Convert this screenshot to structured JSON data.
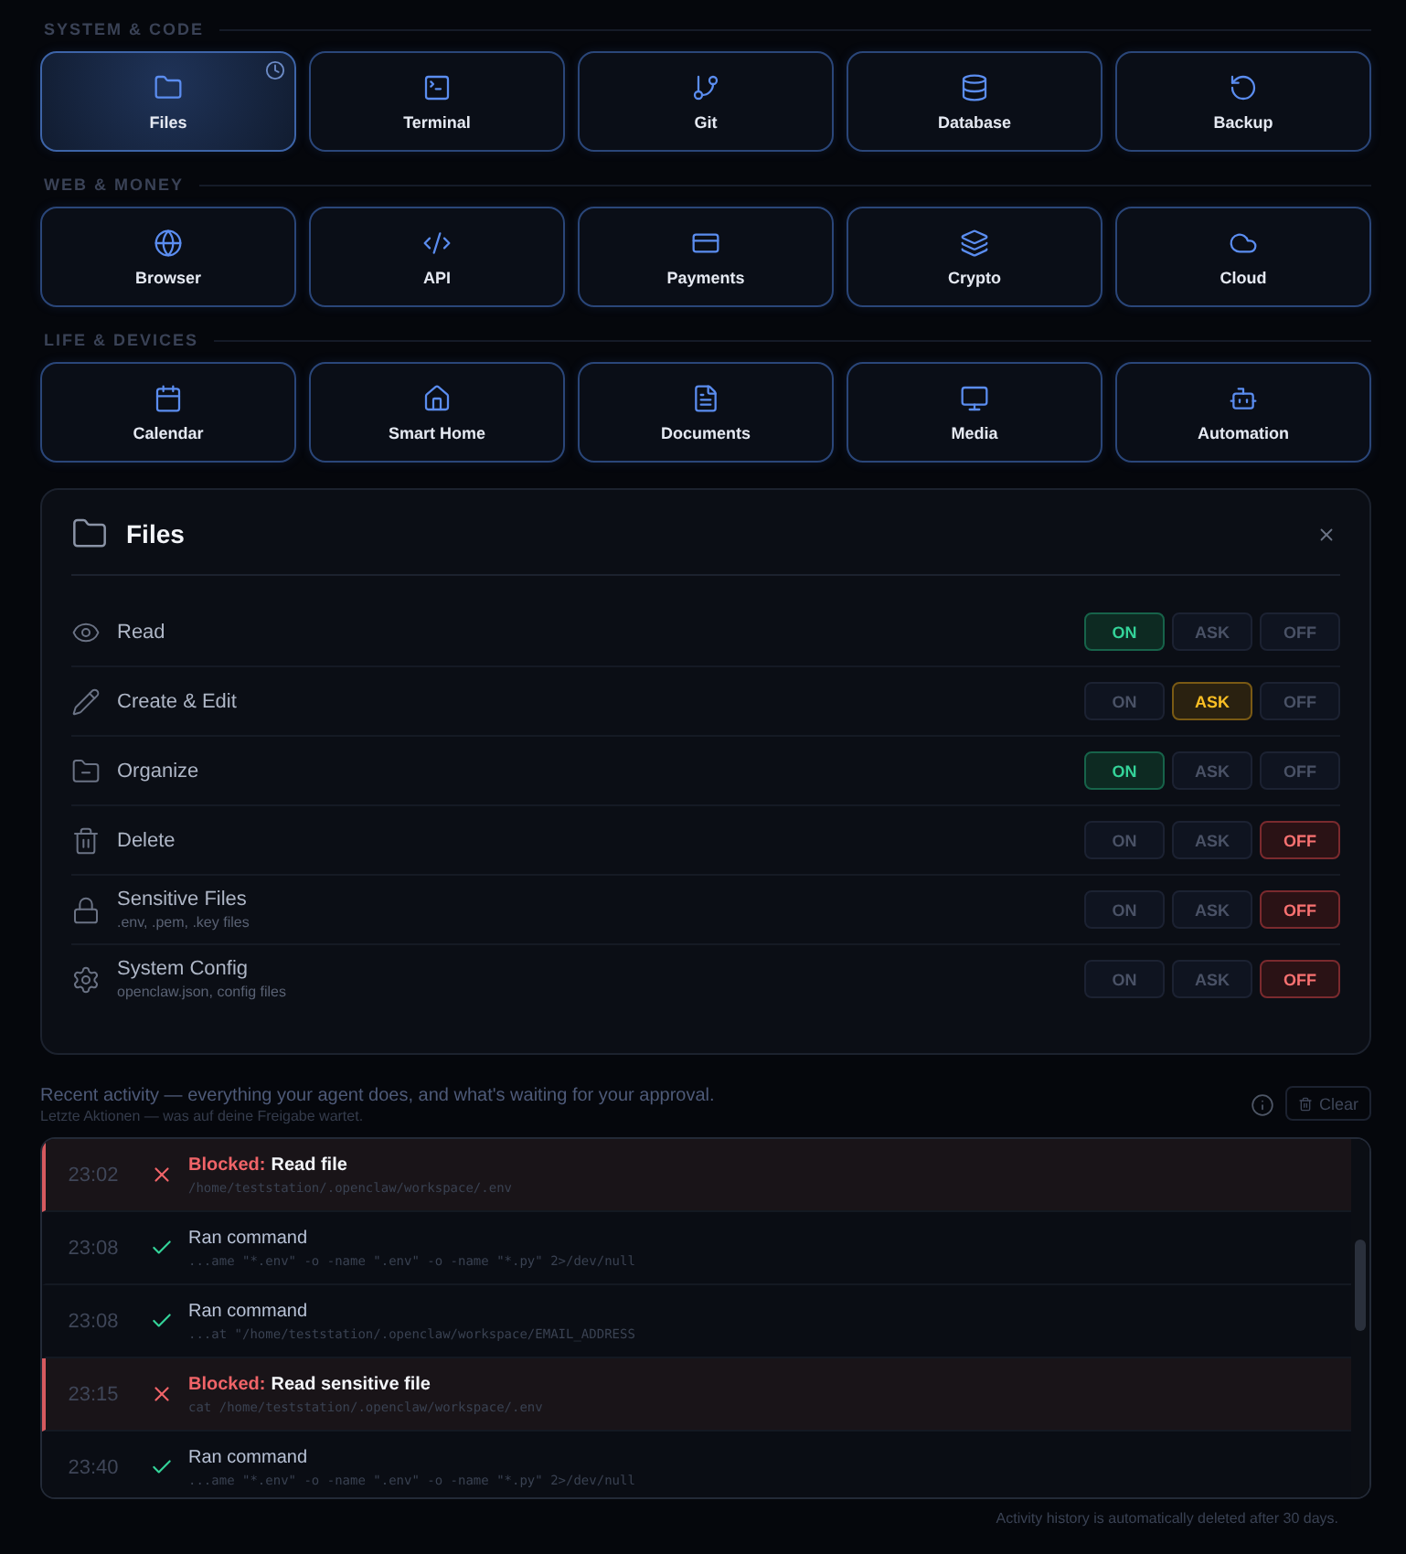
{
  "sections": [
    {
      "title": "SYSTEM & CODE",
      "tiles": [
        {
          "label": "Files",
          "selected": true,
          "pending": true
        },
        {
          "label": "Terminal",
          "selected": false,
          "pending": false
        },
        {
          "label": "Git",
          "selected": false,
          "pending": false
        },
        {
          "label": "Database",
          "selected": false,
          "pending": false
        },
        {
          "label": "Backup",
          "selected": false,
          "pending": false
        }
      ]
    },
    {
      "title": "WEB & MONEY",
      "tiles": [
        {
          "label": "Browser",
          "selected": false,
          "pending": false
        },
        {
          "label": "API",
          "selected": false,
          "pending": false
        },
        {
          "label": "Payments",
          "selected": false,
          "pending": false
        },
        {
          "label": "Crypto",
          "selected": false,
          "pending": false
        },
        {
          "label": "Cloud",
          "selected": false,
          "pending": false
        }
      ]
    },
    {
      "title": "LIFE & DEVICES",
      "tiles": [
        {
          "label": "Calendar",
          "selected": false,
          "pending": false
        },
        {
          "label": "Smart Home",
          "selected": false,
          "pending": false
        },
        {
          "label": "Documents",
          "selected": false,
          "pending": false
        },
        {
          "label": "Media",
          "selected": false,
          "pending": false
        },
        {
          "label": "Automation",
          "selected": false,
          "pending": false
        }
      ]
    }
  ],
  "panel": {
    "title": "Files",
    "permissions": [
      {
        "label": "Read",
        "options": [
          {
            "label": "ON",
            "selected": true
          },
          {
            "label": "ASK",
            "selected": false
          },
          {
            "label": "OFF",
            "selected": false
          }
        ]
      },
      {
        "label": "Create & Edit",
        "options": [
          {
            "label": "ON",
            "selected": false
          },
          {
            "label": "ASK",
            "selected": true
          },
          {
            "label": "OFF",
            "selected": false
          }
        ]
      },
      {
        "label": "Organize",
        "options": [
          {
            "label": "ON",
            "selected": true
          },
          {
            "label": "ASK",
            "selected": false
          },
          {
            "label": "OFF",
            "selected": false
          }
        ]
      },
      {
        "label": "Delete",
        "options": [
          {
            "label": "ON",
            "selected": false
          },
          {
            "label": "ASK",
            "selected": false
          },
          {
            "label": "OFF",
            "selected": true
          }
        ]
      },
      {
        "label": "Sensitive Files",
        "hint": ".env, .pem, .key files",
        "options": [
          {
            "label": "ON",
            "selected": false
          },
          {
            "label": "ASK",
            "selected": false
          },
          {
            "label": "OFF",
            "selected": true
          }
        ]
      },
      {
        "label": "System Config",
        "hint": "openclaw.json, config files",
        "options": [
          {
            "label": "ON",
            "selected": false
          },
          {
            "label": "ASK",
            "selected": false
          },
          {
            "label": "OFF",
            "selected": true
          }
        ]
      }
    ]
  },
  "activity": {
    "title": "Recent activity — everything your agent does, and what's waiting for your approval.",
    "subtitle": "Letzte Aktionen — was auf deine Freigabe wartet.",
    "clear": "Clear",
    "entries": [
      {
        "time": "23:02",
        "blocked": true,
        "flag": "Blocked:",
        "action": "Read file",
        "detail": "/home/teststation/.openclaw/workspace/.env"
      },
      {
        "time": "23:08",
        "blocked": false,
        "action": "Ran command",
        "detail": "...ame \"*.env\" -o -name \".env\" -o -name \"*.py\" 2>/dev/null"
      },
      {
        "time": "23:08",
        "blocked": false,
        "action": "Ran command",
        "detail": "...at \"/home/teststation/.openclaw/workspace/EMAIL_ADDRESS"
      },
      {
        "time": "23:15",
        "blocked": true,
        "flag": "Blocked:",
        "action": "Read sensitive file",
        "detail": "cat /home/teststation/.openclaw/workspace/.env"
      },
      {
        "time": "23:40",
        "blocked": false,
        "action": "Ran command",
        "detail": "...ame \"*.env\" -o -name \".env\" -o -name \"*.py\" 2>/dev/null"
      }
    ],
    "footer": "Activity history is automatically deleted after 30 days."
  }
}
